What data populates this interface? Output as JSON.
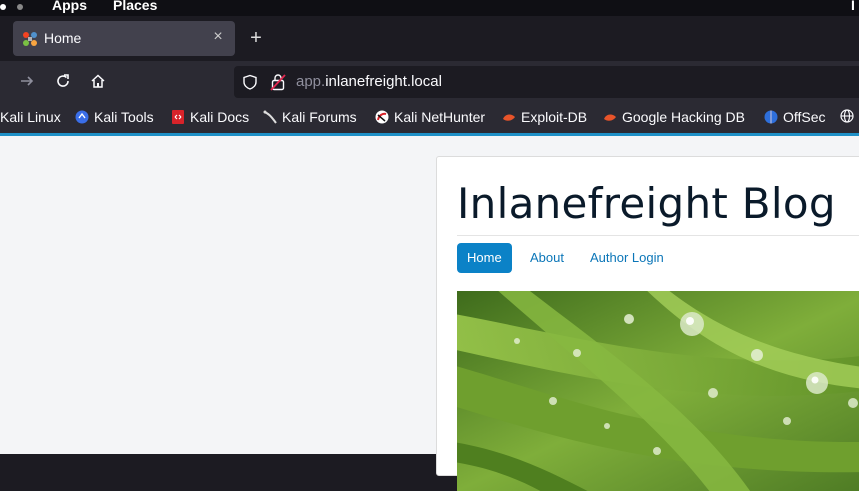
{
  "desktop": {
    "apps_label": "Apps",
    "places_label": "Places",
    "right_edge_text": "I"
  },
  "tab": {
    "title": "Home",
    "close_glyph": "×",
    "new_tab_glyph": "+"
  },
  "urlbar": {
    "url_host_prefix": "app.",
    "url_domain": "inlanefreight.local"
  },
  "bookmarks": [
    {
      "label": "Kali Linux",
      "icon": "kali-linux-icon"
    },
    {
      "label": "Kali Tools",
      "icon": "kali-tools-icon"
    },
    {
      "label": "Kali Docs",
      "icon": "kali-docs-icon"
    },
    {
      "label": "Kali Forums",
      "icon": "kali-forums-icon"
    },
    {
      "label": "Kali NetHunter",
      "icon": "kali-nethunter-icon"
    },
    {
      "label": "Exploit-DB",
      "icon": "exploit-db-icon"
    },
    {
      "label": "Google Hacking DB",
      "icon": "ghdb-icon"
    },
    {
      "label": "OffSec",
      "icon": "offsec-icon"
    }
  ],
  "blog": {
    "title": "Inlanefreight Blog",
    "menu": [
      {
        "label": "Home",
        "active": true
      },
      {
        "label": "About",
        "active": false
      },
      {
        "label": "Author Login",
        "active": false
      }
    ]
  },
  "colors": {
    "accent": "#1e90c7",
    "menu_active_bg": "#0b82c7",
    "link": "#0b76b8"
  }
}
